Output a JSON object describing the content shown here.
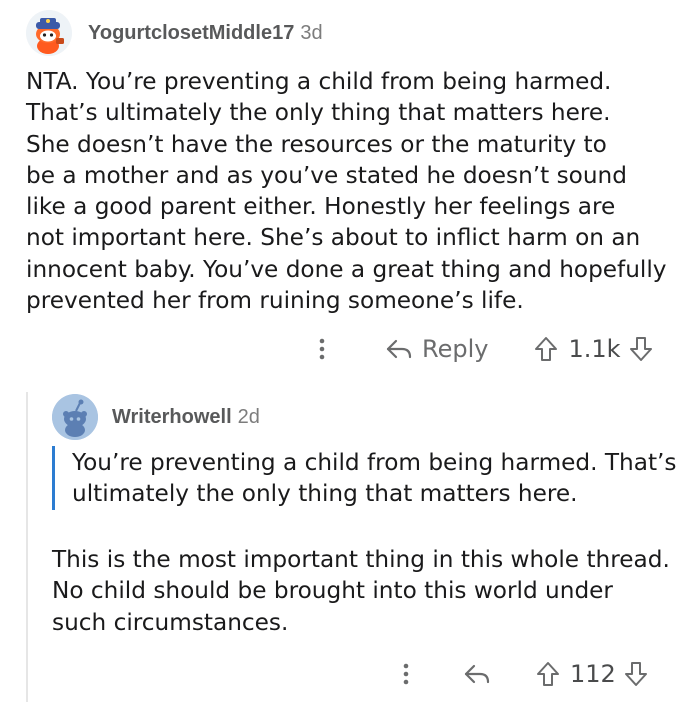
{
  "comments": [
    {
      "username": "YogurtclosetMiddle17",
      "age": "3d",
      "avatar_icon": "snoo-firefighter-avatar-icon",
      "body": [
        "NTA. You’re preventing a child from being harmed.",
        "That’s ultimately the only thing that matters here.",
        "She doesn’t have the resources or the maturity to",
        "be a mother and as you’ve stated he doesn’t sound",
        "like a good parent either. Honestly her feelings are",
        "not important here. She’s about to inflict harm on an",
        "innocent baby. You’ve done a great thing and hopefully",
        "prevented her from ruining someone’s life."
      ],
      "actions": {
        "more_icon": "more-options-icon",
        "reply_icon": "reply-arrow-icon",
        "reply_label": "Reply",
        "upvote_icon": "upvote-arrow-icon",
        "score": "1.1k",
        "downvote_icon": "downvote-arrow-icon"
      }
    },
    {
      "username": "Writerhowell",
      "age": "2d",
      "avatar_icon": "default-snoo-avatar-icon",
      "quote": [
        "You’re preventing a child from being harmed. That’s",
        "ultimately the only thing that matters here."
      ],
      "body": [
        "This is the most important thing in this whole thread.",
        "No child should be brought into this world under",
        "such circumstances."
      ],
      "actions": {
        "more_icon": "more-options-icon",
        "reply_icon": "reply-arrow-icon",
        "upvote_icon": "upvote-arrow-icon",
        "score": "112",
        "downvote_icon": "downvote-arrow-icon"
      }
    }
  ],
  "colors": {
    "text": "#1a1a1b",
    "meta": "#7c7c7c",
    "action": "#6b6c6d",
    "quote_bar": "#2c7cd1",
    "thread_line": "#e6e6e6",
    "avatar2_bg": "#a9c4e2"
  }
}
